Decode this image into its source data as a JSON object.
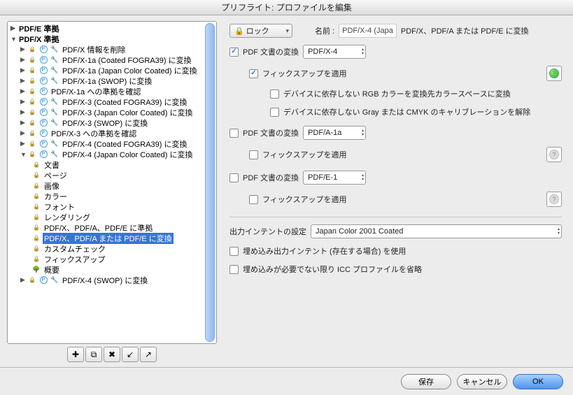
{
  "title": "プリフライト: プロファイルを編集",
  "tree": {
    "root1": "PDF/E 準拠",
    "root2": "PDF/X 準拠",
    "items": [
      "PDF/X 情報を削除",
      "PDF/X-1a (Coated FOGRA39) に変換",
      "PDF/X-1a (Japan Color Coated) に変換",
      "PDF/X-1a (SWOP) に変換",
      "PDF/X-1a への準拠を確認",
      "PDF/X-3 (Coated FOGRA39) に変換",
      "PDF/X-3 (Japan Color Coated) に変換",
      "PDF/X-3 (SWOP) に変換",
      "PDF/X-3 への準拠を確認",
      "PDF/X-4 (Coated FOGRA39) に変換",
      "PDF/X-4 (Japan Color Coated) に変換"
    ],
    "children": [
      "文書",
      "ページ",
      "画像",
      "カラー",
      "フォント",
      "レンダリング",
      "PDF/X、PDF/A、PDF/E に準拠",
      "PDF/X、PDF/A または PDF/E に変換",
      "カスタムチェック",
      "フィックスアップ",
      "概要"
    ],
    "last": "PDF/X-4 (SWOP) に変換"
  },
  "lock": "ロック",
  "name_label": "名前 :",
  "name_value": "PDF/X-4 (Japa",
  "name_tail": "PDF/X、PDF/A または PDF/E に変換",
  "conv_label": "PDF 文書の変換",
  "conv1": "PDF/X-4",
  "conv2": "PDF/A-1a",
  "conv3": "PDF/E-1",
  "fixup": "フィックスアップを適用",
  "devrgb": "デバイスに依存しない RGB カラーを変換先カラースペースに変換",
  "devgray": "デバイスに依存しない Gray または CMYK のキャリブレーションを解除",
  "out_label": "出力インテントの設定",
  "out_value": "Japan Color 2001 Coated",
  "embed1": "埋め込み出力インテント (存在する場合) を使用",
  "embed2": "埋め込みが必要でない限り ICC プロファイルを省略",
  "btn_save": "保存",
  "btn_cancel": "キャンセル",
  "btn_ok": "OK"
}
